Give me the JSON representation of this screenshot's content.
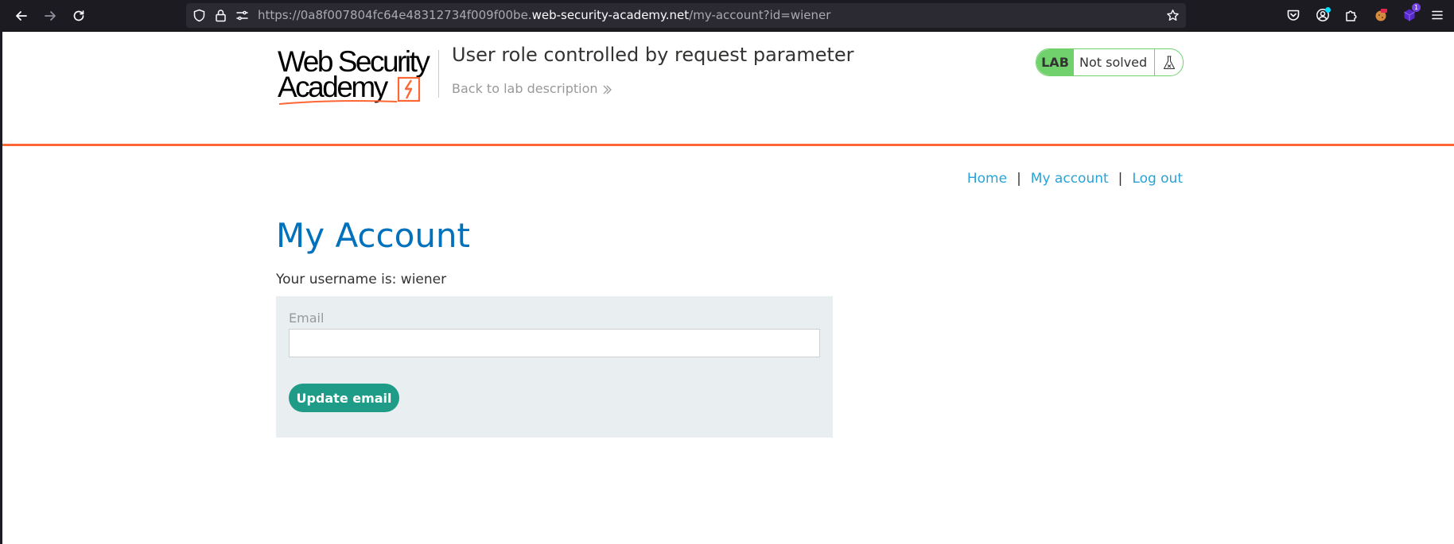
{
  "browser": {
    "url_prefix": "https://0a8f007804fc64e48312734f009f00be.",
    "url_domain": "web-security-academy.net",
    "url_path": "/my-account?id=wiener",
    "extensions_badge": "1"
  },
  "header": {
    "logo_line1": "Web Security",
    "logo_line2": "Academy",
    "lab_title": "User role controlled by request parameter",
    "back_link": "Back to lab description",
    "lab_badge": "LAB",
    "lab_status": "Not solved"
  },
  "nav": {
    "home": "Home",
    "my_account": "My account",
    "log_out": "Log out",
    "separator": "|"
  },
  "main": {
    "heading": "My Account",
    "username_text": "Your username is: wiener",
    "email_label": "Email",
    "email_value": "",
    "update_button": "Update email"
  },
  "colors": {
    "accent_orange": "#ff6633",
    "heading_blue": "#0071bc",
    "link_blue": "#29a3d6",
    "lab_green": "#70d16d",
    "button_teal": "#1e9c88",
    "panel_bg": "#e9eef0"
  },
  "icons": {
    "back": "arrow-left-icon",
    "forward": "arrow-right-icon",
    "reload": "reload-icon",
    "shield": "shield-icon",
    "lock": "lock-icon",
    "permissions": "permissions-icon",
    "bookmark": "star-icon",
    "pocket": "pocket-icon",
    "account": "account-icon",
    "extensions": "puzzle-icon",
    "menu": "hamburger-menu-icon",
    "lab_flask": "flask-icon"
  }
}
